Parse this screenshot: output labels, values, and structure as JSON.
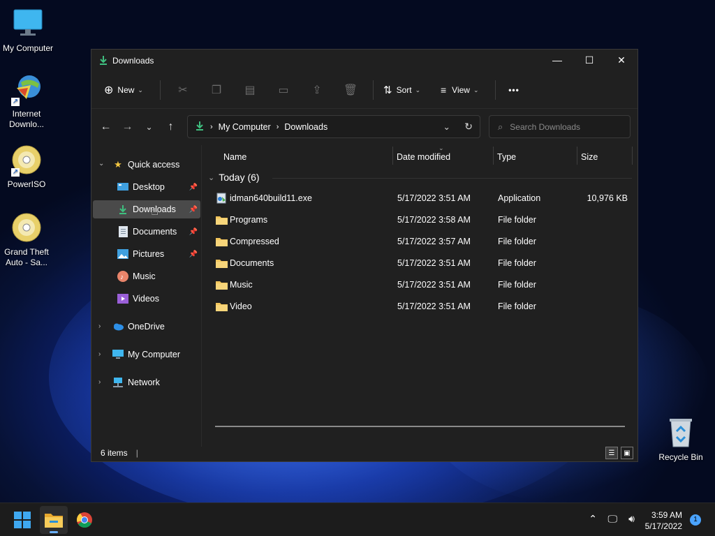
{
  "desktop": {
    "icons": [
      {
        "label_line1": "My Computer",
        "label_line2": ""
      },
      {
        "label_line1": "Internet",
        "label_line2": "Downlo..."
      },
      {
        "label_line1": "PowerISO",
        "label_line2": ""
      },
      {
        "label_line1": "Grand Theft",
        "label_line2": "Auto - Sa..."
      },
      {
        "label_line1": "Recycle Bin",
        "label_line2": ""
      }
    ]
  },
  "window": {
    "title": "Downloads",
    "controls": {
      "minimize": "—",
      "maximize": "☐",
      "close": "✕"
    }
  },
  "toolbar": {
    "new_label": "New",
    "sort_label": "Sort",
    "view_label": "View",
    "more_label": "•••"
  },
  "address": {
    "crumbs": [
      "My Computer",
      "Downloads"
    ],
    "search_placeholder": "Search Downloads"
  },
  "sidebar": {
    "quick_access": "Quick access",
    "items": [
      {
        "label": "Desktop",
        "pinned": true
      },
      {
        "label": "Downloads",
        "pinned": true
      },
      {
        "label": "Documents",
        "pinned": true
      },
      {
        "label": "Pictures",
        "pinned": true
      },
      {
        "label": "Music",
        "pinned": false
      },
      {
        "label": "Videos",
        "pinned": false
      }
    ],
    "onedrive": "OneDrive",
    "mycomputer": "My Computer",
    "network": "Network"
  },
  "columns": {
    "name": "Name",
    "date": "Date modified",
    "type": "Type",
    "size": "Size"
  },
  "group": {
    "label": "Today (6)"
  },
  "files": [
    {
      "name": "idman640build11.exe",
      "date": "5/17/2022 3:51 AM",
      "type": "Application",
      "size": "10,976 KB"
    },
    {
      "name": "Programs",
      "date": "5/17/2022 3:58 AM",
      "type": "File folder",
      "size": ""
    },
    {
      "name": "Compressed",
      "date": "5/17/2022 3:57 AM",
      "type": "File folder",
      "size": ""
    },
    {
      "name": "Documents",
      "date": "5/17/2022 3:51 AM",
      "type": "File folder",
      "size": ""
    },
    {
      "name": "Music",
      "date": "5/17/2022 3:51 AM",
      "type": "File folder",
      "size": ""
    },
    {
      "name": "Video",
      "date": "5/17/2022 3:51 AM",
      "type": "File folder",
      "size": ""
    }
  ],
  "status": {
    "count": "6 items"
  },
  "taskbar": {
    "time": "3:59 AM",
    "date": "5/17/2022",
    "notifications": "1"
  },
  "colors": {
    "accent": "#4aa3ff",
    "folder": "#f2c55c",
    "window_bg": "#202020"
  }
}
